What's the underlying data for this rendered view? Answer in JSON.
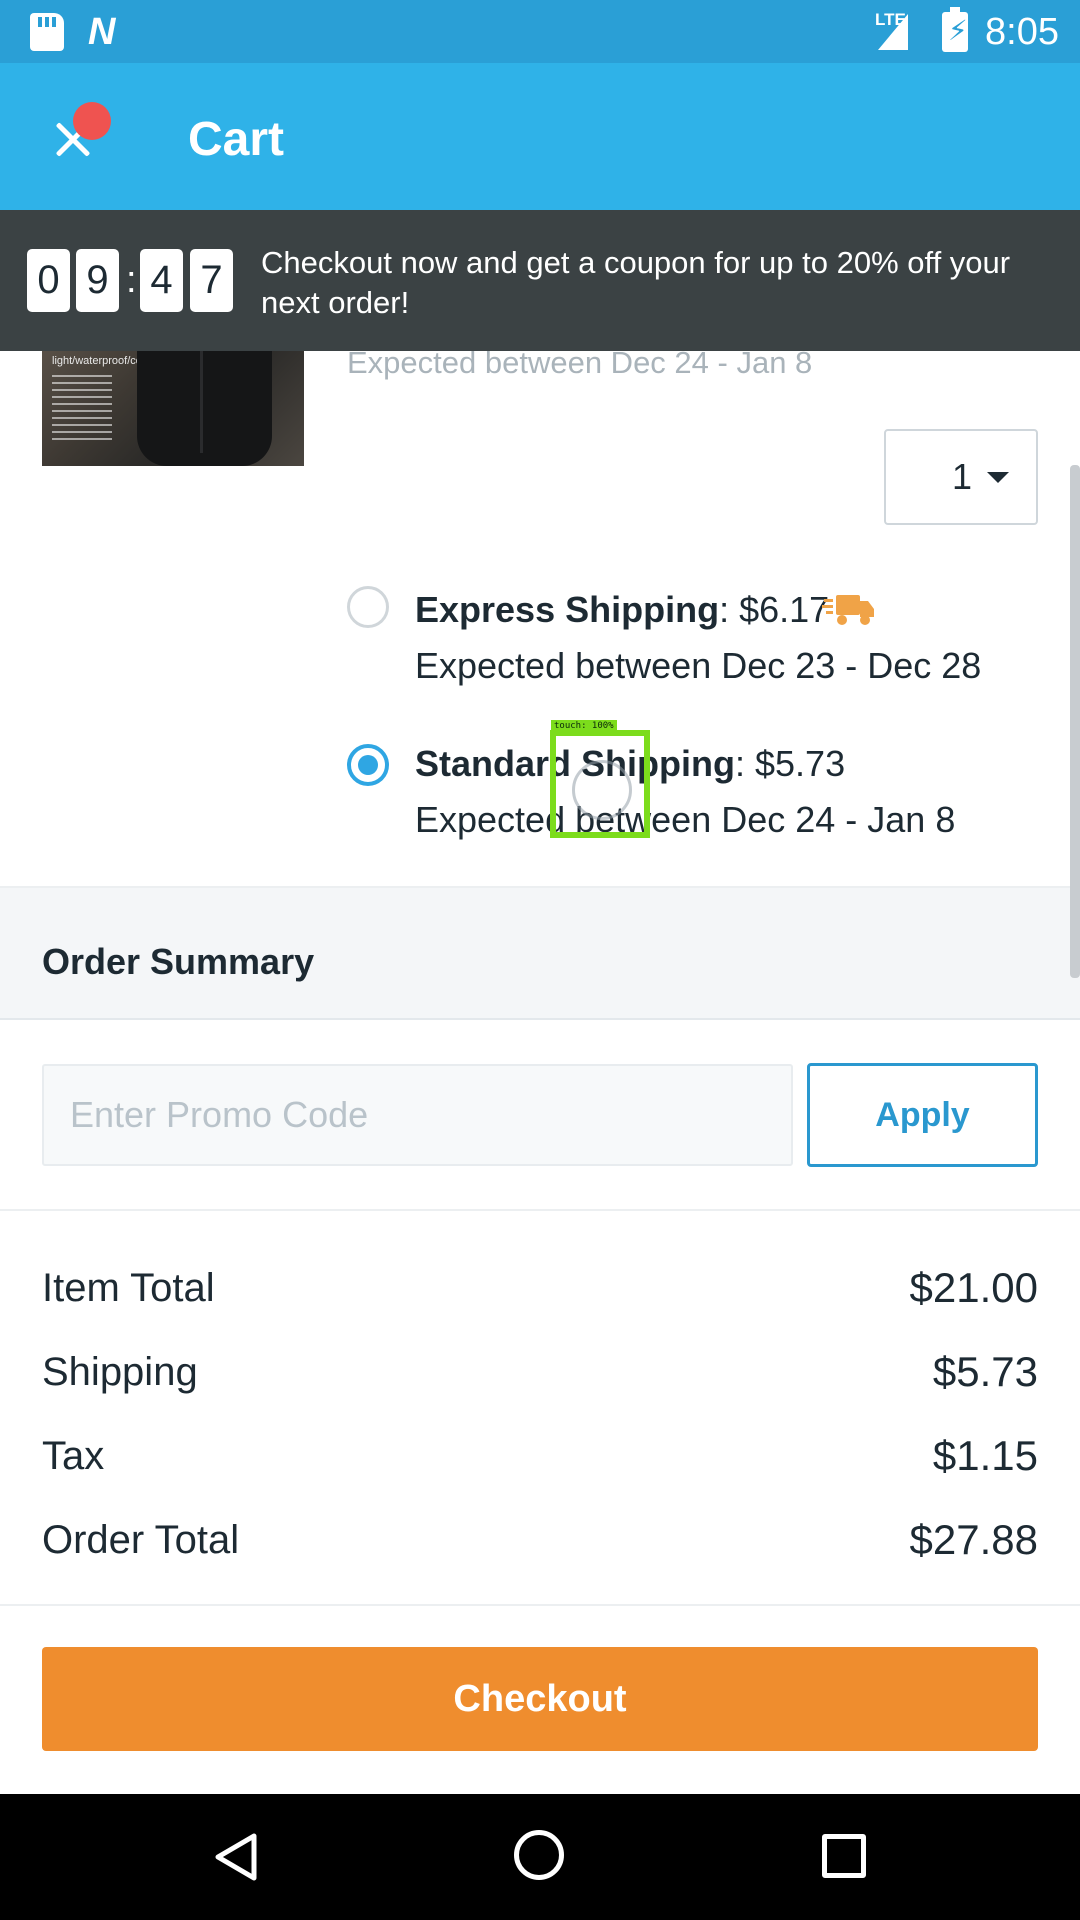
{
  "status_bar": {
    "network": "LTE",
    "time": "8:05"
  },
  "app_bar": {
    "title": "Cart"
  },
  "promo_banner": {
    "countdown": [
      "0",
      "9",
      "4",
      "7"
    ],
    "separator": ":",
    "message": "Checkout now and get a coupon for up to 20% off your next order!"
  },
  "cart_item": {
    "image_caption": "light/waterproof/comfort",
    "expected": "Expected between Dec 24 - Jan 8",
    "quantity": "1",
    "shipping_options": [
      {
        "name": "Express Shipping",
        "price": ": $6.17",
        "expected": "Expected between Dec 23 - Dec 28",
        "selected": false,
        "icon": "truck-icon"
      },
      {
        "name": "Standard Shipping",
        "price": ": $5.73",
        "expected": "Expected between Dec 24 - Jan 8",
        "selected": true
      }
    ]
  },
  "touch_overlay": {
    "label": "touch: 100%"
  },
  "order_summary": {
    "title": "Order Summary",
    "promo_placeholder": "Enter Promo Code",
    "apply_label": "Apply",
    "rows": [
      {
        "label": "Item Total",
        "value": "$21.00"
      },
      {
        "label": "Shipping",
        "value": "$5.73"
      },
      {
        "label": "Tax",
        "value": "$1.15"
      },
      {
        "label": "Order Total",
        "value": "$27.88"
      }
    ],
    "checkout_label": "Checkout"
  },
  "colors": {
    "app_bar": "#2fb2e8",
    "accent": "#2fa6e3",
    "checkout": "#ef8d2e",
    "banner": "#3b4244",
    "notification_dot": "#ef5350"
  }
}
